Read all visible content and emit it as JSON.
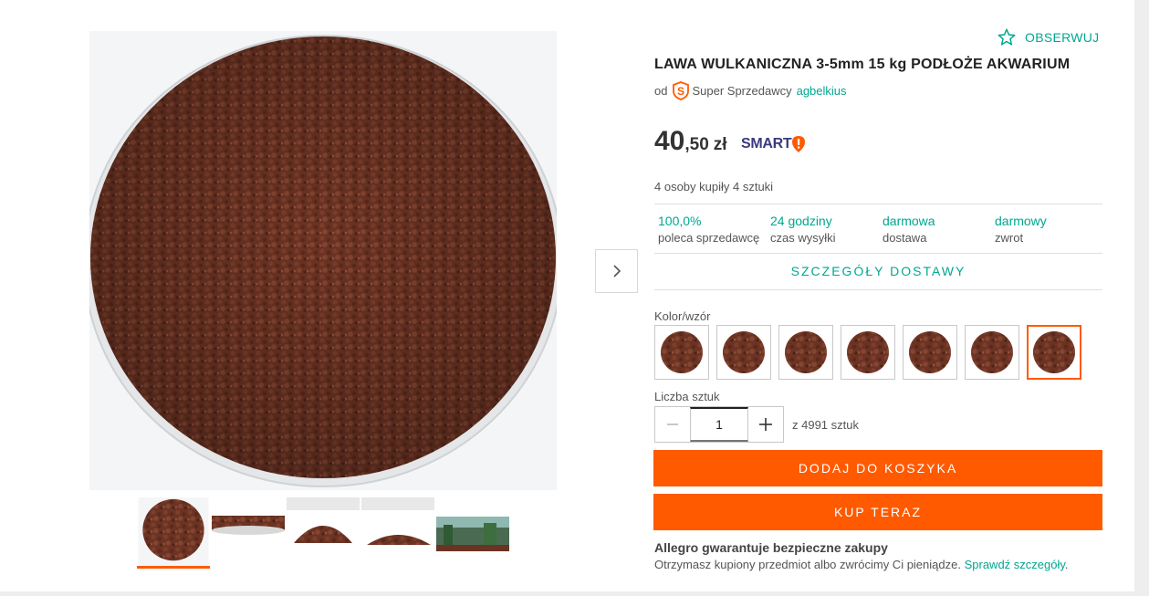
{
  "product": {
    "title": "LAWA WULKANICZNA 3-5mm 15 kg PODŁOŻE AKWARIUM",
    "follow_label": "OBSERWUJ",
    "seller_prefix": "od",
    "seller_badge": "Super Sprzedawcy",
    "seller_name": "agbelkius"
  },
  "price": {
    "main": "40",
    "cents": ",50",
    "currency": "zł",
    "smart_label": "SMART"
  },
  "bought_info": "4 osoby kupiły 4 sztuki",
  "stats": [
    {
      "value": "100,0%",
      "label": "poleca sprzedawcę"
    },
    {
      "value": "24 godziny",
      "label": "czas wysyłki"
    },
    {
      "value": "darmowa",
      "label": "dostawa"
    },
    {
      "value": "darmowy",
      "label": "zwrot"
    }
  ],
  "delivery_details_label": "SZCZEGÓŁY DOSTAWY",
  "variants": {
    "label": "Kolor/wzór",
    "count": 7,
    "selected_index": 6
  },
  "quantity": {
    "label": "Liczba sztuk",
    "value": "1",
    "available": "z 4991 sztuk"
  },
  "buttons": {
    "add_to_cart": "DODAJ DO KOSZYKA",
    "buy_now": "KUP TERAZ"
  },
  "guarantee": {
    "title": "Allegro gwarantuje bezpieczne zakupy",
    "text": "Otrzymasz kupiony przedmiot albo zwrócimy Ci pieniądze.",
    "link": "Sprawdź szczegóły",
    "period": "."
  },
  "gallery": {
    "thumbnail_count": 5,
    "active_index": 0
  },
  "colors": {
    "accent": "#ff5a00",
    "link": "#00a790",
    "gravel": "#6b3323"
  }
}
